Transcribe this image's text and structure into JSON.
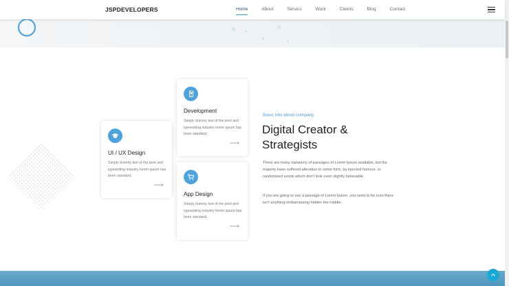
{
  "header": {
    "logo": "JSPDEVELOPERS",
    "nav": [
      {
        "label": "Home",
        "active": true
      },
      {
        "label": "About",
        "active": false
      },
      {
        "label": "Servics",
        "active": false
      },
      {
        "label": "Work",
        "active": false
      },
      {
        "label": "Clients",
        "active": false
      },
      {
        "label": "Blog",
        "active": false
      },
      {
        "label": "Contact",
        "active": false
      }
    ],
    "menu_icon": "hamburger-icon"
  },
  "services": [
    {
      "title": "UI / UX Design",
      "icon": "graduation-cap-icon",
      "text": "Simply dummy text of the print and typesetting industry lorem ipsum has been standard.",
      "arrow": "⟶"
    },
    {
      "title": "Development",
      "icon": "mobile-device-icon",
      "text": "Simply dummy text of the print and typesetting industry lorem ipsum has been standard.",
      "arrow": "⟶"
    },
    {
      "title": "App Design",
      "icon": "shopping-cart-icon",
      "text": "Simply dummy text of the print and typesetting industry lorem ipsum has been standard.",
      "arrow": "⟶"
    }
  ],
  "about": {
    "subtitle": "Basic info about company",
    "heading": "Digital Creator & Strategists",
    "paragraph1": "There are many variations of passages of Lorem Ipsum available, but the majority have suffered alteration in some form, by injected humour, or randomised words which don't look even slightly believable.",
    "paragraph2": "If you are going to use a passage of Lorem Ipsum, you need to be sure there isn't anything embarrassing hidden the middle."
  },
  "colors": {
    "accent": "#4ea3dd",
    "band": "#5a9ec6",
    "to_top": "#1aa9d6"
  },
  "back_to_top_icon": "chevron-up-icon"
}
